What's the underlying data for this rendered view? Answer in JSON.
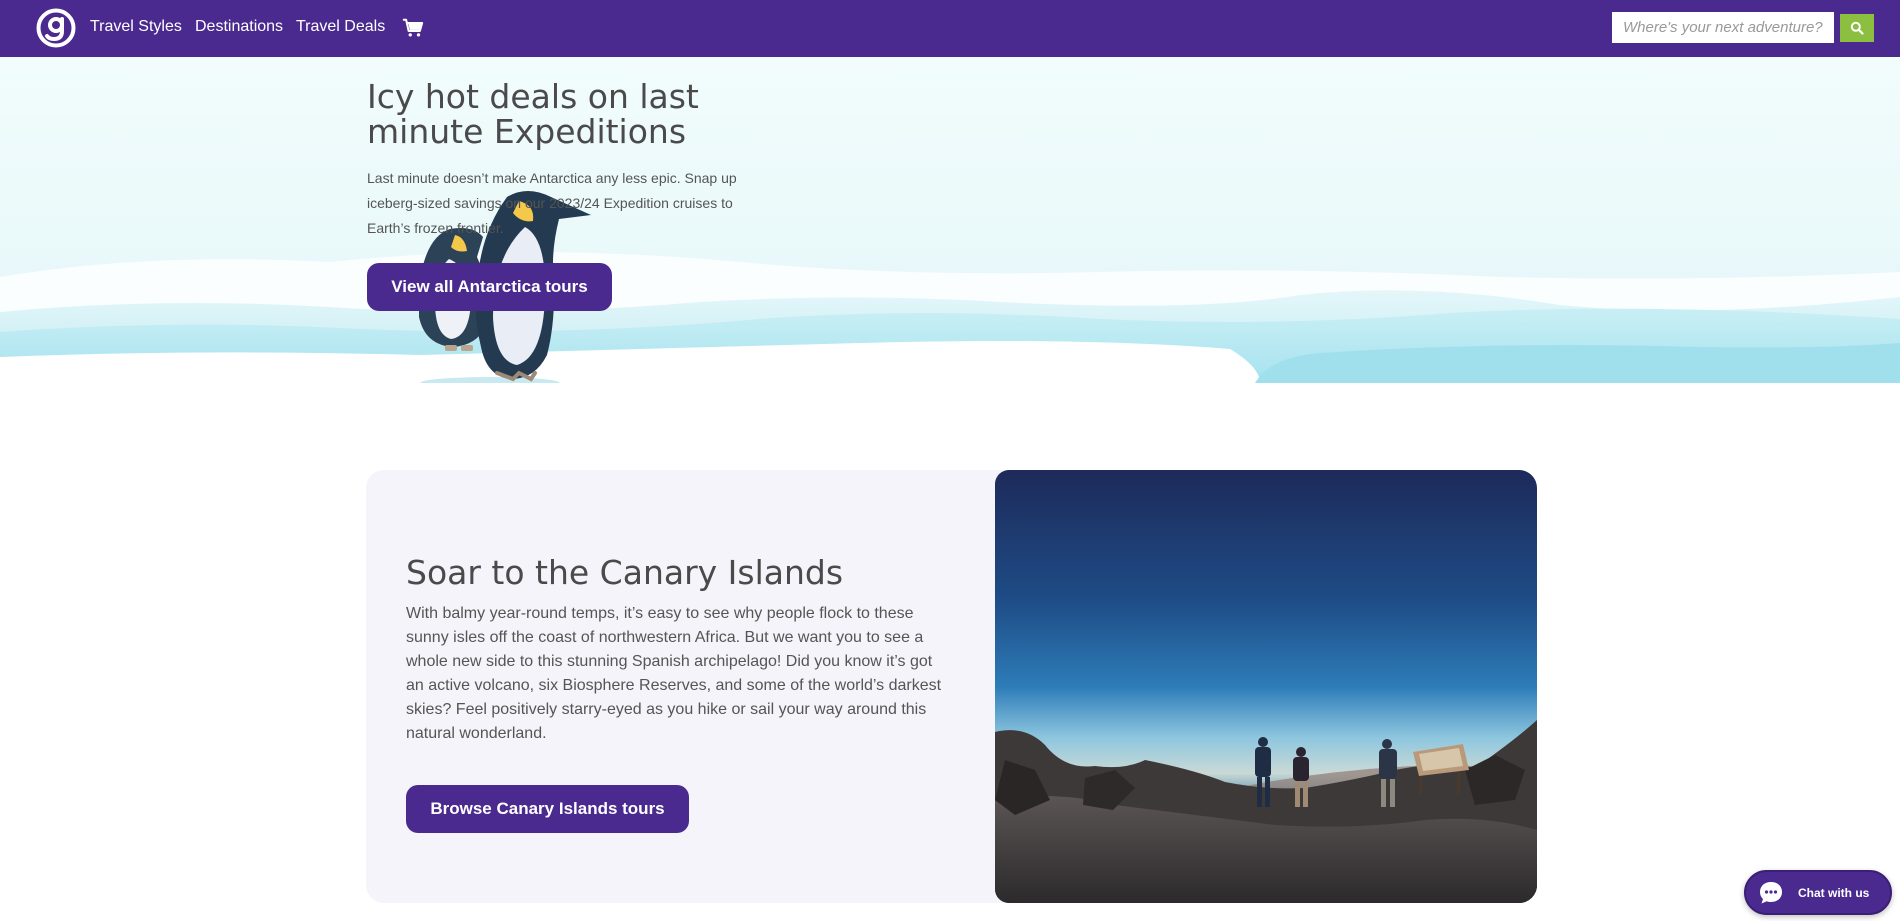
{
  "nav": {
    "links": [
      "Travel Styles",
      "Destinations",
      "Travel Deals"
    ],
    "cart_icon": "shopping-cart-icon",
    "search": {
      "placeholder": "Where's your next adventure?",
      "value": ""
    },
    "search_icon": "search-icon"
  },
  "hero": {
    "title": "Icy hot deals on last minute Expeditions",
    "text": "Last minute doesn’t make Antarctica any less epic. Snap up iceberg-sized savings on our 2023/24 Expedition cruises to Earth’s frozen frontier.",
    "button": "View all Antarctica tours"
  },
  "promo": {
    "title": "Soar to the Canary Islands",
    "text": "With balmy year-round temps, it’s easy to see why people flock to these sunny isles off the coast of northwestern Africa. But we want you to see a whole new side to this stunning Spanish archipelago! Did you know it’s got an active volcano, six Biosphere Reserves, and some of the world’s darkest skies? Feel positively starry-eyed as you hike or sail your way around this natural wonderland.",
    "button": "Browse Canary Islands tours"
  },
  "chat": {
    "label": "Chat with us",
    "icon": "chat-bubble-icon"
  },
  "colors": {
    "brand_purple": "#4b2a8f",
    "search_green": "#8cbf3f"
  }
}
